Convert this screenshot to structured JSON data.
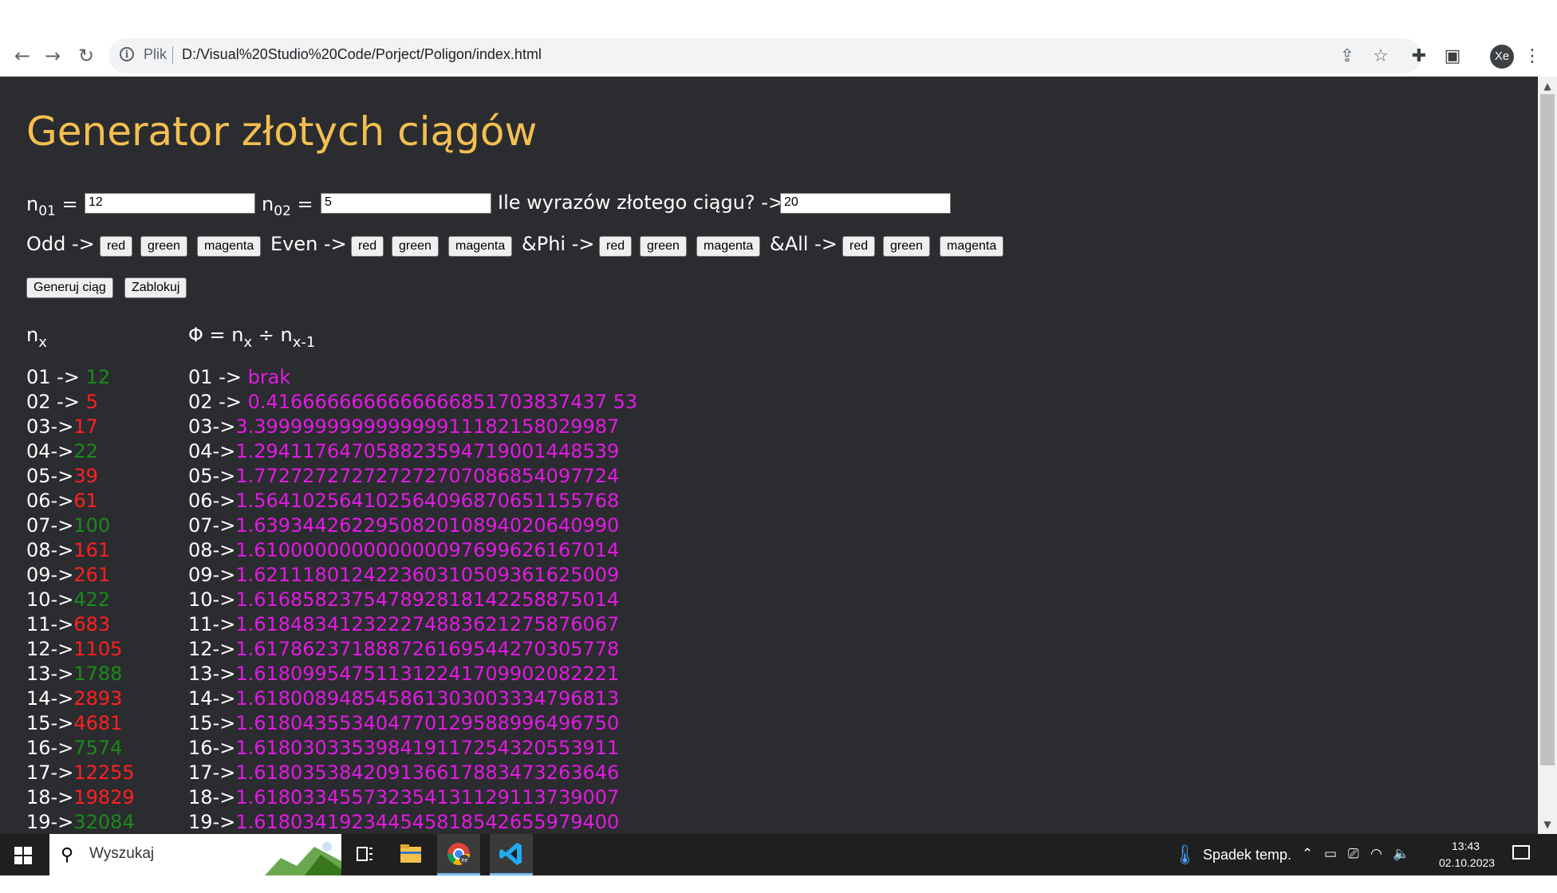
{
  "browser": {
    "scheme_label": "Plik",
    "url": "D:/Visual%20Studio%20Code/Porject/Poligon/index.html",
    "avatar_initials": "Xe",
    "icons": [
      "back-icon",
      "forward-icon",
      "reload-icon",
      "info-icon",
      "share-icon",
      "star-icon",
      "extensions-icon",
      "side-panel-icon",
      "menu-icon"
    ]
  },
  "page": {
    "title": "Generator złotych ciągów",
    "inputs": {
      "n01_label": "n",
      "n01_sub": "01",
      "n01_eq": "=",
      "n01_value": "12",
      "n02_label": "n",
      "n02_sub": "02",
      "n02_eq": "=",
      "n02_value": "5",
      "count_label": "Ile wyrazów złotego ciągu? ->",
      "count_value": "20"
    },
    "color_groups": {
      "odd_label": "Odd ->",
      "even_label": "Even ->",
      "phi_label": "&Phi ->",
      "all_label": "&All ->",
      "red": "red",
      "green": "green",
      "magenta": "magenta"
    },
    "actions": {
      "generate": "Generuj ciąg",
      "lock": "Zablokuj"
    },
    "columns": {
      "n_head": "n",
      "n_head_sub": "x",
      "phi_head_a": "Φ = n",
      "phi_head_sub1": "x",
      "phi_head_b": " ÷ n",
      "phi_head_sub2": "x-1"
    },
    "colors": {
      "red": "#ff2020",
      "green": "#1a8a1a",
      "magenta": "#e21ae2",
      "title": "#f4bf50",
      "background": "#2b2c30"
    },
    "sequence": [
      {
        "prefix": "01 -> ",
        "value": "12",
        "color": "green"
      },
      {
        "prefix": "02 -> ",
        "value": "5",
        "color": "red"
      },
      {
        "prefix": "03->",
        "value": "17",
        "color": "red"
      },
      {
        "prefix": "04->",
        "value": "22",
        "color": "green"
      },
      {
        "prefix": "05->",
        "value": "39",
        "color": "red"
      },
      {
        "prefix": "06->",
        "value": "61",
        "color": "red"
      },
      {
        "prefix": "07->",
        "value": "100",
        "color": "green"
      },
      {
        "prefix": "08->",
        "value": "161",
        "color": "red"
      },
      {
        "prefix": "09->",
        "value": "261",
        "color": "red"
      },
      {
        "prefix": "10->",
        "value": "422",
        "color": "green"
      },
      {
        "prefix": "11->",
        "value": "683",
        "color": "red"
      },
      {
        "prefix": "12->",
        "value": "1105",
        "color": "red"
      },
      {
        "prefix": "13->",
        "value": "1788",
        "color": "green"
      },
      {
        "prefix": "14->",
        "value": "2893",
        "color": "red"
      },
      {
        "prefix": "15->",
        "value": "4681",
        "color": "red"
      },
      {
        "prefix": "16->",
        "value": "7574",
        "color": "green"
      },
      {
        "prefix": "17->",
        "value": "12255",
        "color": "red"
      },
      {
        "prefix": "18->",
        "value": "19829",
        "color": "red"
      },
      {
        "prefix": "19->",
        "value": "32084",
        "color": "green"
      }
    ],
    "ratios": [
      {
        "prefix": "01 -> ",
        "value": "brak"
      },
      {
        "prefix": "02 -> ",
        "value": "0.4166666666666666851703837437 53"
      },
      {
        "prefix": "03->",
        "value": "3.399999999999999911182158029987"
      },
      {
        "prefix": "04->",
        "value": "1.294117647058823594719001448539"
      },
      {
        "prefix": "05->",
        "value": "1.772727272727272707086854097724"
      },
      {
        "prefix": "06->",
        "value": "1.564102564102564096870651155768"
      },
      {
        "prefix": "07->",
        "value": "1.639344262295082010894020640990"
      },
      {
        "prefix": "08->",
        "value": "1.610000000000000097699626167014"
      },
      {
        "prefix": "09->",
        "value": "1.621118012422360310509361625009"
      },
      {
        "prefix": "10->",
        "value": "1.616858237547892818142258875014"
      },
      {
        "prefix": "11->",
        "value": "1.618483412322274883621275876067"
      },
      {
        "prefix": "12->",
        "value": "1.617862371888726169544270305778"
      },
      {
        "prefix": "13->",
        "value": "1.618099547511312241709902082221"
      },
      {
        "prefix": "14->",
        "value": "1.618008948545861303003334796813"
      },
      {
        "prefix": "15->",
        "value": "1.618043553404770129588996496750"
      },
      {
        "prefix": "16->",
        "value": "1.618030335398419117254320553911"
      },
      {
        "prefix": "17->",
        "value": "1.618035384209136617883473263646"
      },
      {
        "prefix": "18->",
        "value": "1.618033455732354131129113739007"
      },
      {
        "prefix": "19->",
        "value": "1.618034192344545818542655979400"
      }
    ]
  },
  "taskbar": {
    "search_placeholder": "Wyszukaj",
    "weather": "Spadek temp.",
    "time": "13:43",
    "date": "02.10.2023"
  }
}
